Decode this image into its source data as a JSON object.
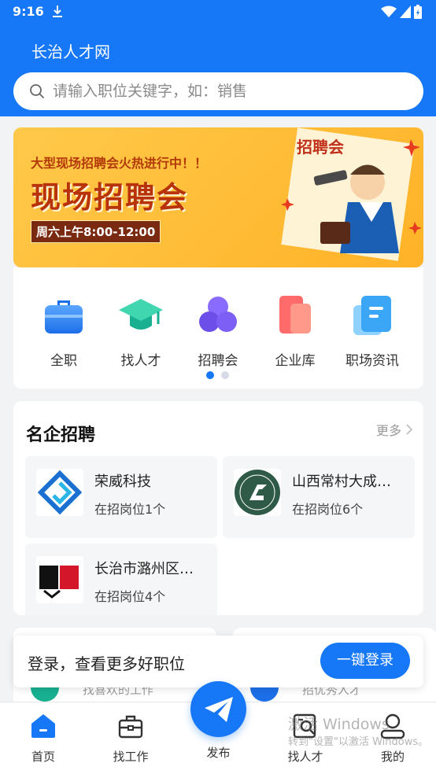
{
  "status_bar": {
    "time": "9:16"
  },
  "header": {
    "title": "长治人才网",
    "search_placeholder": "请输入职位关键字，如：销售"
  },
  "banner": {
    "subtitle": "大型现场招聘会火热进行中！！",
    "title": "现场招聘会",
    "time": "周六上午8:00-12:00",
    "sign_text": "招聘会"
  },
  "quick_nav": {
    "items": [
      {
        "label": "全职",
        "icon": "briefcase-icon"
      },
      {
        "label": "找人才",
        "icon": "graduation-cap-icon"
      },
      {
        "label": "招聘会",
        "icon": "circles-icon"
      },
      {
        "label": "企业库",
        "icon": "building-icon"
      },
      {
        "label": "职场资讯",
        "icon": "news-icon"
      }
    ],
    "page_count": 2,
    "active_page": 1
  },
  "companies": {
    "title": "名企招聘",
    "more": "更多",
    "items": [
      {
        "name": "荣威科技",
        "count": "在招岗位1个"
      },
      {
        "name": "山西常村大成…",
        "count": "在招岗位6个"
      },
      {
        "name": "长治市潞州区…",
        "count": "在招岗位4个"
      }
    ]
  },
  "peek_cards": [
    {
      "text": "找喜欢的工作"
    },
    {
      "text": "招优秀人才"
    }
  ],
  "login_banner": {
    "text": "登录，查看更多好职位",
    "button": "一键登录"
  },
  "tab_bar": {
    "tabs": [
      {
        "label": "首页",
        "icon": "home-icon",
        "active": true
      },
      {
        "label": "找工作",
        "icon": "briefcase-icon",
        "active": false
      },
      {
        "label": "发布",
        "icon": "send-icon",
        "active": false
      },
      {
        "label": "找人才",
        "icon": "person-search-icon",
        "active": false
      },
      {
        "label": "我的",
        "icon": "user-icon",
        "active": false
      }
    ]
  },
  "watermark": {
    "line1": "激活 Windows",
    "line2": "转到\"设置\"以激活 Windows。"
  },
  "colors": {
    "primary": "#1677f7",
    "background": "#f2f3f5",
    "banner": "#ffb227"
  }
}
